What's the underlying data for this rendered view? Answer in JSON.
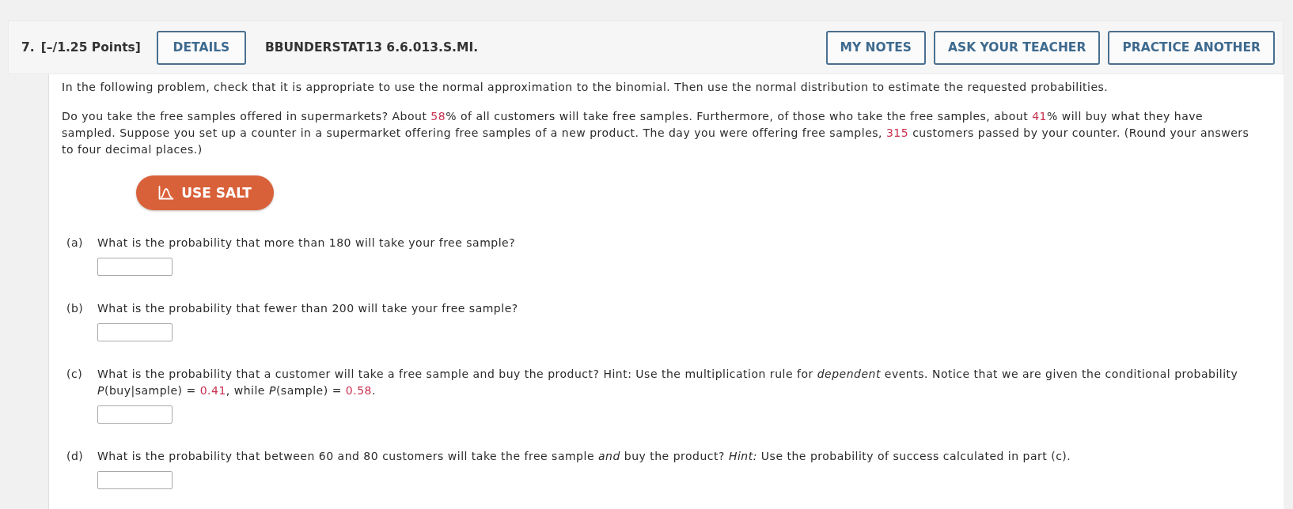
{
  "question": {
    "number": "7.",
    "points": "[–/1.25 Points]",
    "details_button": "DETAILS",
    "code": "BBUNDERSTAT13 6.6.013.S.MI.",
    "actions": [
      "MY NOTES",
      "ASK YOUR TEACHER",
      "PRACTICE ANOTHER"
    ]
  },
  "instructions": "In the following problem, check that it is appropriate to use the normal approximation to the binomial. Then use the normal distribution to estimate the requested probabilities.",
  "problem": [
    {
      "kind": "text",
      "text": "Do you take the free samples offered in supermarkets? About "
    },
    {
      "kind": "value",
      "text": "58"
    },
    {
      "kind": "text",
      "text": "% of all customers will take free samples. Furthermore, of those who take the free samples, about "
    },
    {
      "kind": "value",
      "text": "41"
    },
    {
      "kind": "text",
      "text": "% will buy what they have sampled. Suppose you set up a counter in a supermarket offering free samples of a new product. The day you were offering free samples, "
    },
    {
      "kind": "value",
      "text": "315"
    },
    {
      "kind": "text",
      "text": " customers passed by your counter. (Round your answers to four decimal places.)"
    }
  ],
  "salt_button": "USE SALT",
  "parts": [
    {
      "label": "(a)",
      "question": [
        {
          "kind": "text",
          "text": "What is the probability that more than 180 will take your free sample?"
        }
      ]
    },
    {
      "label": "(b)",
      "question": [
        {
          "kind": "text",
          "text": "What is the probability that fewer than 200 will take your free sample?"
        }
      ]
    },
    {
      "label": "(c)",
      "question": [
        {
          "kind": "text",
          "text": "What is the probability that a customer will take a free sample and buy the product? Hint: Use the multiplication rule for *dependent* events. Notice that we are given the conditional probability *P*(buy|sample) = "
        },
        {
          "kind": "value",
          "text": "0.41"
        },
        {
          "kind": "text",
          "text": ", while *P*(sample) = "
        },
        {
          "kind": "value",
          "text": "0.58"
        },
        {
          "kind": "text",
          "text": "."
        }
      ]
    },
    {
      "label": "(d)",
      "question": [
        {
          "kind": "text",
          "text": "What is the probability that between 60 and 80 customers will take the free sample *and* buy the product? *Hint:* Use the probability of success calculated in part (c)."
        }
      ]
    }
  ]
}
